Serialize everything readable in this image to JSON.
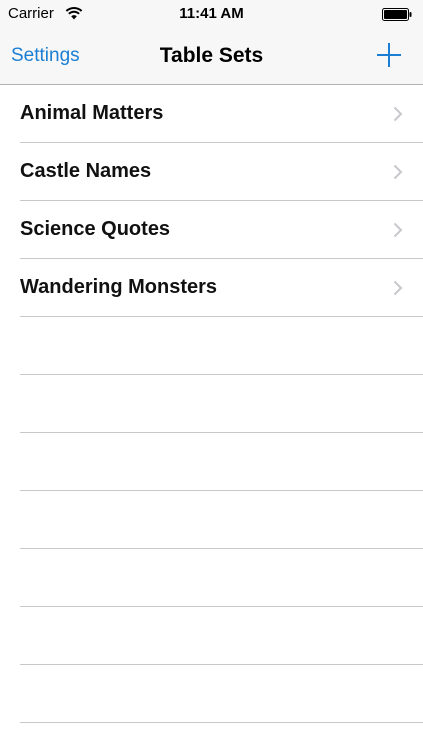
{
  "status_bar": {
    "carrier": "Carrier",
    "time": "11:41 AM"
  },
  "nav": {
    "left_button": "Settings",
    "title": "Table Sets",
    "add_icon": "plus-icon"
  },
  "table": {
    "items": [
      {
        "label": "Animal Matters"
      },
      {
        "label": "Castle Names"
      },
      {
        "label": "Science Quotes"
      },
      {
        "label": "Wandering Monsters"
      }
    ]
  },
  "colors": {
    "accent": "#1a7fd4",
    "bar_background": "#f7f7f8",
    "separator": "#c8c7cc",
    "chevron": "#c7c7cc"
  }
}
